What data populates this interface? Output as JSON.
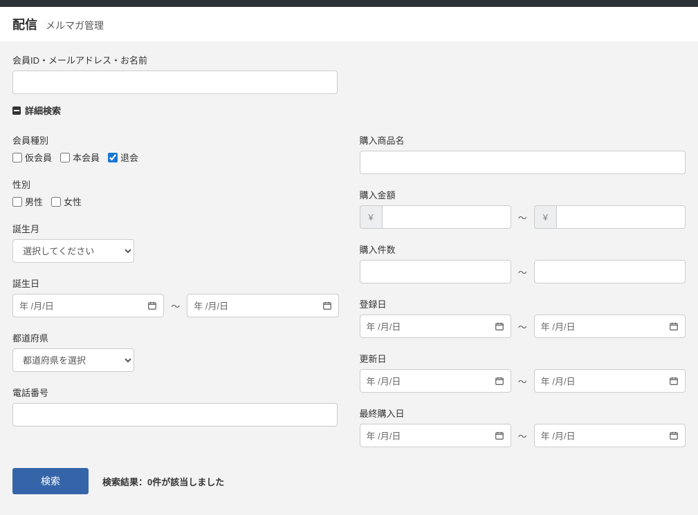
{
  "page": {
    "title": "配信",
    "subtitle": "メルマガ管理"
  },
  "search": {
    "keyword_label": "会員ID・メールアドレス・お名前",
    "toggle_label": "詳細検索"
  },
  "left": {
    "member_type": {
      "label": "会員種別",
      "options": [
        {
          "label": "仮会員",
          "checked": false
        },
        {
          "label": "本会員",
          "checked": false
        },
        {
          "label": "退会",
          "checked": true
        }
      ]
    },
    "gender": {
      "label": "性別",
      "options": [
        {
          "label": "男性",
          "checked": false
        },
        {
          "label": "女性",
          "checked": false
        }
      ]
    },
    "birth_month": {
      "label": "誕生月",
      "placeholder": "選択してください"
    },
    "birth_day": {
      "label": "誕生日",
      "placeholder": "年 /月/日"
    },
    "prefecture": {
      "label": "都道府県",
      "placeholder": "都道府県を選択"
    },
    "phone": {
      "label": "電話番号"
    }
  },
  "right": {
    "product_name": {
      "label": "購入商品名"
    },
    "amount": {
      "label": "購入金額",
      "currency": "¥"
    },
    "count": {
      "label": "購入件数"
    },
    "reg_date": {
      "label": "登録日",
      "placeholder": "年 /月/日"
    },
    "update_date": {
      "label": "更新日",
      "placeholder": "年 /月/日"
    },
    "last_purchase": {
      "label": "最終購入日",
      "placeholder": "年 /月/日"
    }
  },
  "range_sep": "〜",
  "footer": {
    "search_btn": "検索",
    "result": "検索結果：0件が該当しました"
  }
}
